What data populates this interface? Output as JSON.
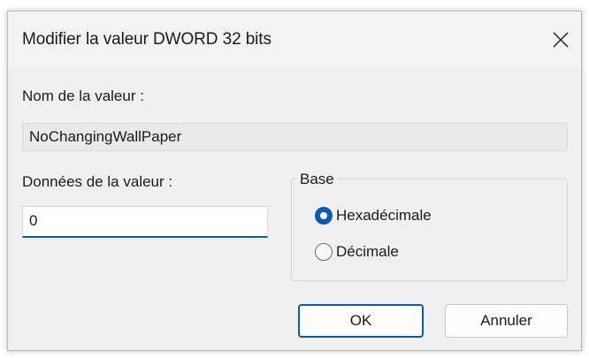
{
  "dialog": {
    "title": "Modifier la valeur DWORD 32 bits"
  },
  "value_name": {
    "label": "Nom de la valeur :",
    "value": "NoChangingWallPaper"
  },
  "value_data": {
    "label": "Données de la valeur :",
    "value": "0"
  },
  "base": {
    "legend": "Base",
    "options": [
      {
        "label": "Hexadécimale",
        "checked": true
      },
      {
        "label": "Décimale",
        "checked": false
      }
    ]
  },
  "buttons": {
    "ok_label": "OK",
    "cancel_label": "Annuler"
  },
  "colors": {
    "accent": "#0b5cad",
    "dialog_bg": "#f0f0f0",
    "readonly_field_bg": "#e9e9e9"
  },
  "icons": {
    "close": "close-icon"
  }
}
